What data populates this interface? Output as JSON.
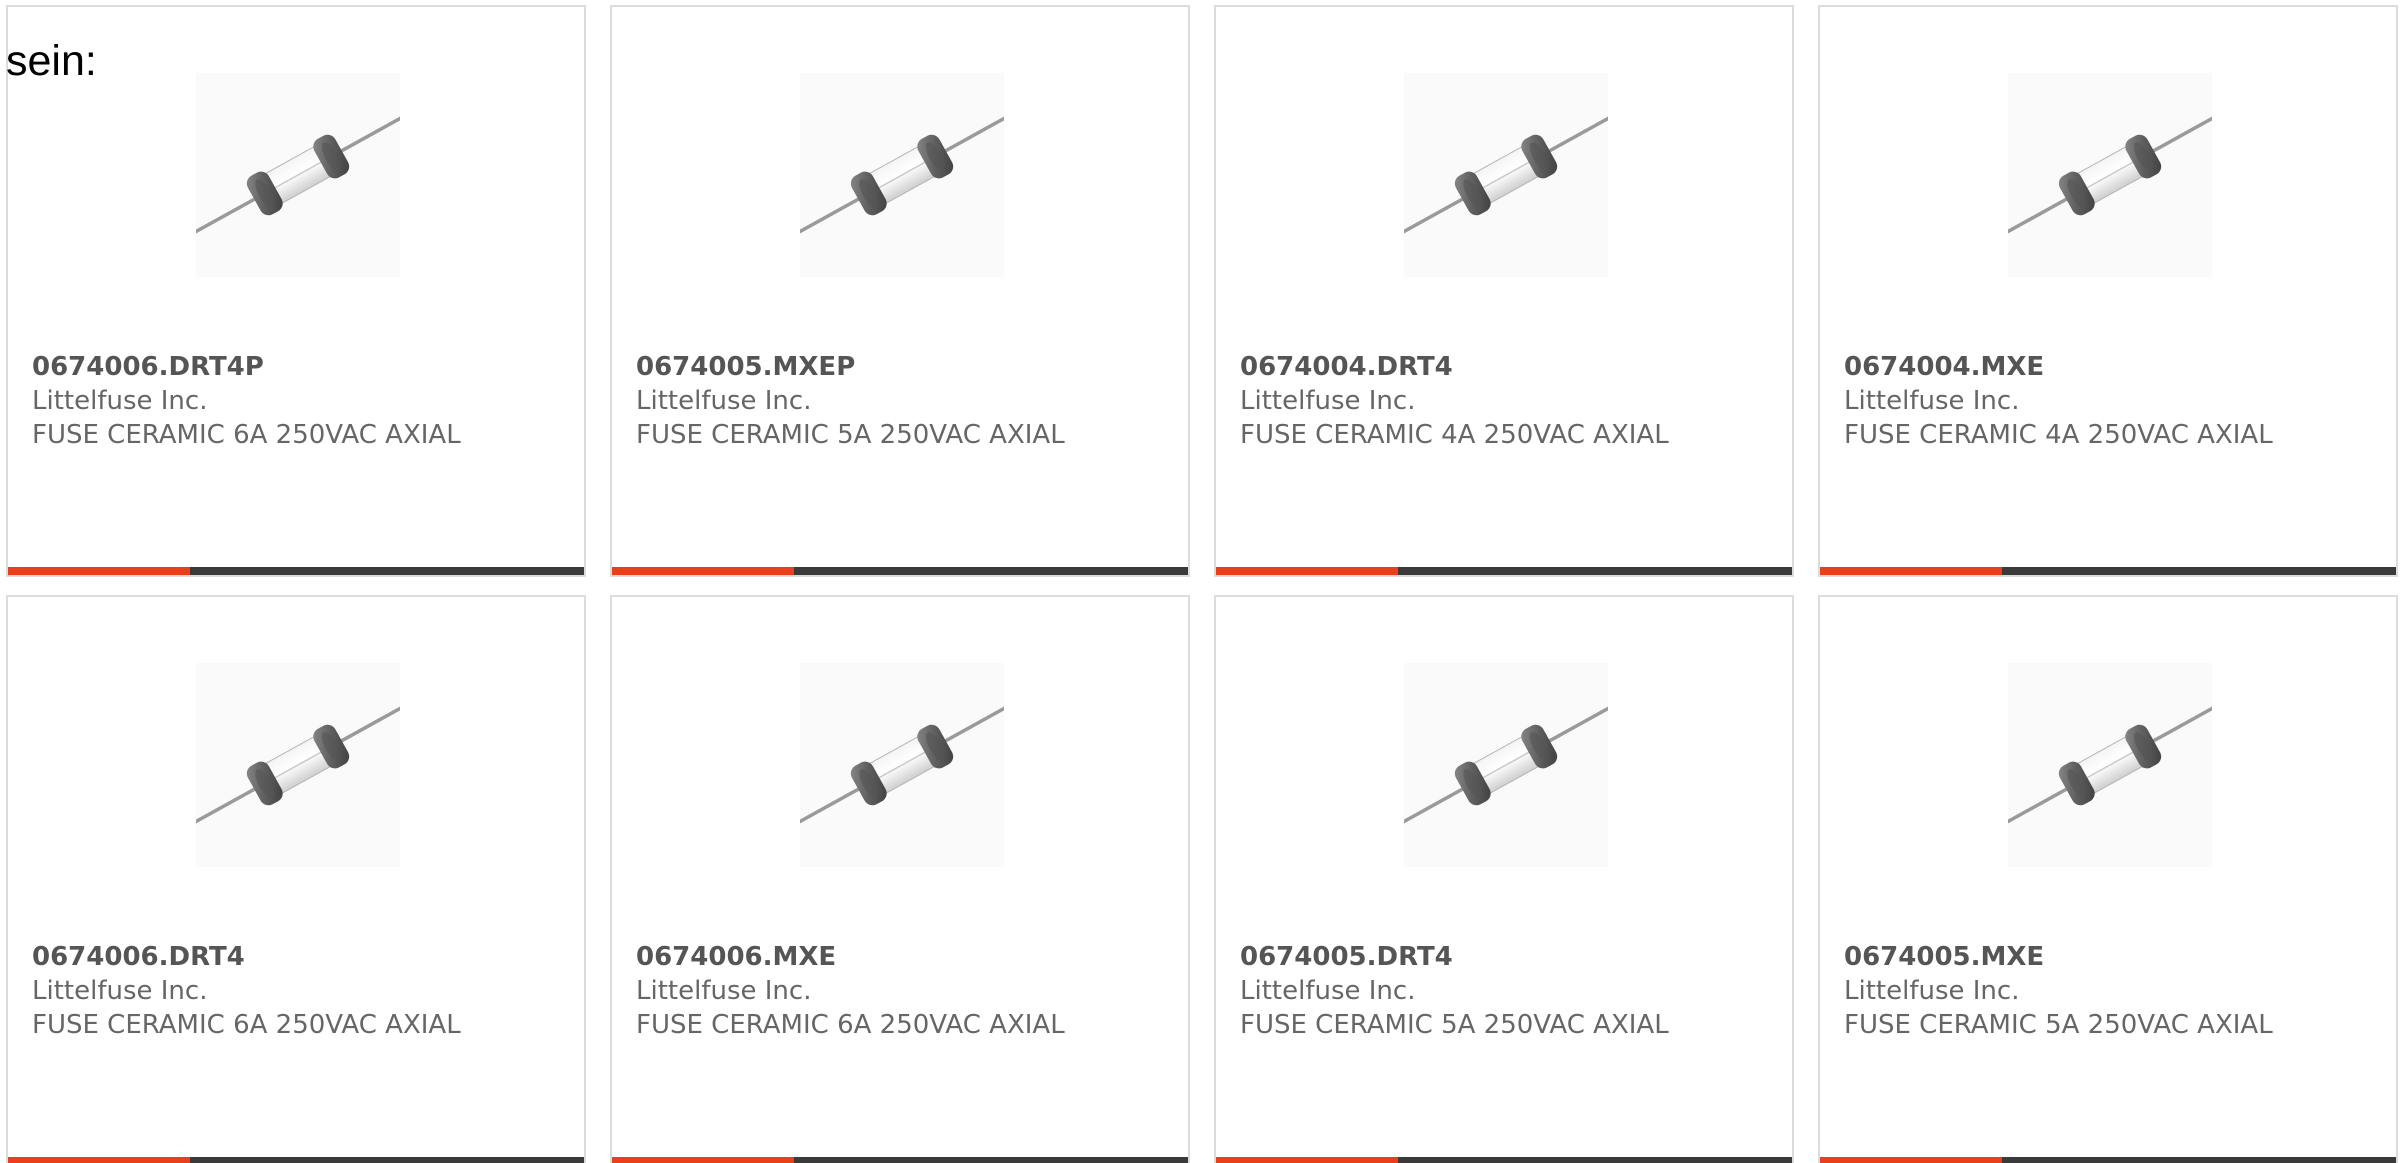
{
  "intro": {
    "text": "sein:"
  },
  "colors": {
    "accent": "#e8401c",
    "bar": "#3a3a3a",
    "border": "#dcdcdc",
    "text": "#666666"
  },
  "products": [
    {
      "part_number": "0674006.DRT4P",
      "manufacturer": "Littelfuse Inc.",
      "description": "FUSE CERAMIC 6A 250VAC AXIAL",
      "icon": "fuse-image"
    },
    {
      "part_number": "0674005.MXEP",
      "manufacturer": "Littelfuse Inc.",
      "description": "FUSE CERAMIC 5A 250VAC AXIAL",
      "icon": "fuse-image"
    },
    {
      "part_number": "0674004.DRT4",
      "manufacturer": "Littelfuse Inc.",
      "description": "FUSE CERAMIC 4A 250VAC AXIAL",
      "icon": "fuse-image"
    },
    {
      "part_number": "0674004.MXE",
      "manufacturer": "Littelfuse Inc.",
      "description": "FUSE CERAMIC 4A 250VAC AXIAL",
      "icon": "fuse-image"
    },
    {
      "part_number": "0674006.DRT4",
      "manufacturer": "Littelfuse Inc.",
      "description": "FUSE CERAMIC 6A 250VAC AXIAL",
      "icon": "fuse-image"
    },
    {
      "part_number": "0674006.MXE",
      "manufacturer": "Littelfuse Inc.",
      "description": "FUSE CERAMIC 6A 250VAC AXIAL",
      "icon": "fuse-image"
    },
    {
      "part_number": "0674005.DRT4",
      "manufacturer": "Littelfuse Inc.",
      "description": "FUSE CERAMIC 5A 250VAC AXIAL",
      "icon": "fuse-image"
    },
    {
      "part_number": "0674005.MXE",
      "manufacturer": "Littelfuse Inc.",
      "description": "FUSE CERAMIC 5A 250VAC AXIAL",
      "icon": "fuse-image"
    }
  ]
}
